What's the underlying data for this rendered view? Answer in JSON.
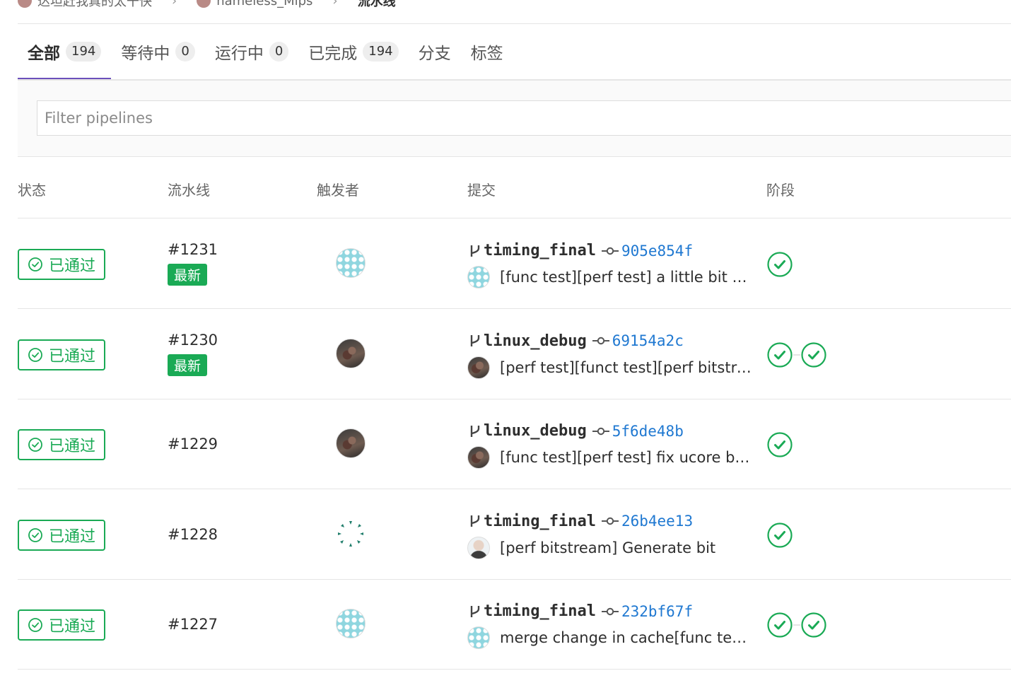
{
  "breadcrumb": {
    "items": [
      {
        "label": "达坦赶我真的太干快"
      },
      {
        "label": "nameless_Mips"
      }
    ],
    "current": "流水线"
  },
  "tabs": [
    {
      "label": "全部",
      "count": "194",
      "active": true
    },
    {
      "label": "等待中",
      "count": "0"
    },
    {
      "label": "运行中",
      "count": "0"
    },
    {
      "label": "已完成",
      "count": "194"
    },
    {
      "label": "分支"
    },
    {
      "label": "标签"
    }
  ],
  "filter": {
    "placeholder": "Filter pipelines"
  },
  "table": {
    "headers": {
      "status": "状态",
      "pipeline": "流水线",
      "triggerer": "触发者",
      "commit": "提交",
      "stages": "阶段"
    },
    "rows": [
      {
        "status": "已通过",
        "id": "#1231",
        "latest": "最新",
        "triggerer_avatar": "identicon",
        "branch": "timing_final",
        "sha": "905e854f",
        "message": "[func test][perf test] a little bit ch...",
        "author_avatar": "identicon",
        "stages": [
          "passed"
        ]
      },
      {
        "status": "已通过",
        "id": "#1230",
        "latest": "最新",
        "triggerer_avatar": "photo",
        "branch": "linux_debug",
        "sha": "69154a2c",
        "message": "[perf test][funct test][perf bitstrea...",
        "author_avatar": "photo",
        "stages": [
          "passed",
          "passed"
        ]
      },
      {
        "status": "已通过",
        "id": "#1229",
        "latest": "",
        "triggerer_avatar": "photo",
        "branch": "linux_debug",
        "sha": "5f6de48b",
        "message": "[func test][perf test] fix ucore boo...",
        "author_avatar": "photo",
        "stages": [
          "passed"
        ]
      },
      {
        "status": "已通过",
        "id": "#1228",
        "latest": "",
        "triggerer_avatar": "dots",
        "branch": "timing_final",
        "sha": "26b4ee13",
        "message": "[perf bitstream] Generate bit",
        "author_avatar": "person",
        "stages": [
          "passed"
        ]
      },
      {
        "status": "已通过",
        "id": "#1227",
        "latest": "",
        "triggerer_avatar": "identicon",
        "branch": "timing_final",
        "sha": "232bf67f",
        "message": "merge change in cache[func test]...",
        "author_avatar": "identicon",
        "stages": [
          "passed",
          "passed"
        ]
      }
    ]
  },
  "colors": {
    "success": "#1aaa55",
    "link": "#1f78d1",
    "active_tab": "#6b4fbb"
  }
}
